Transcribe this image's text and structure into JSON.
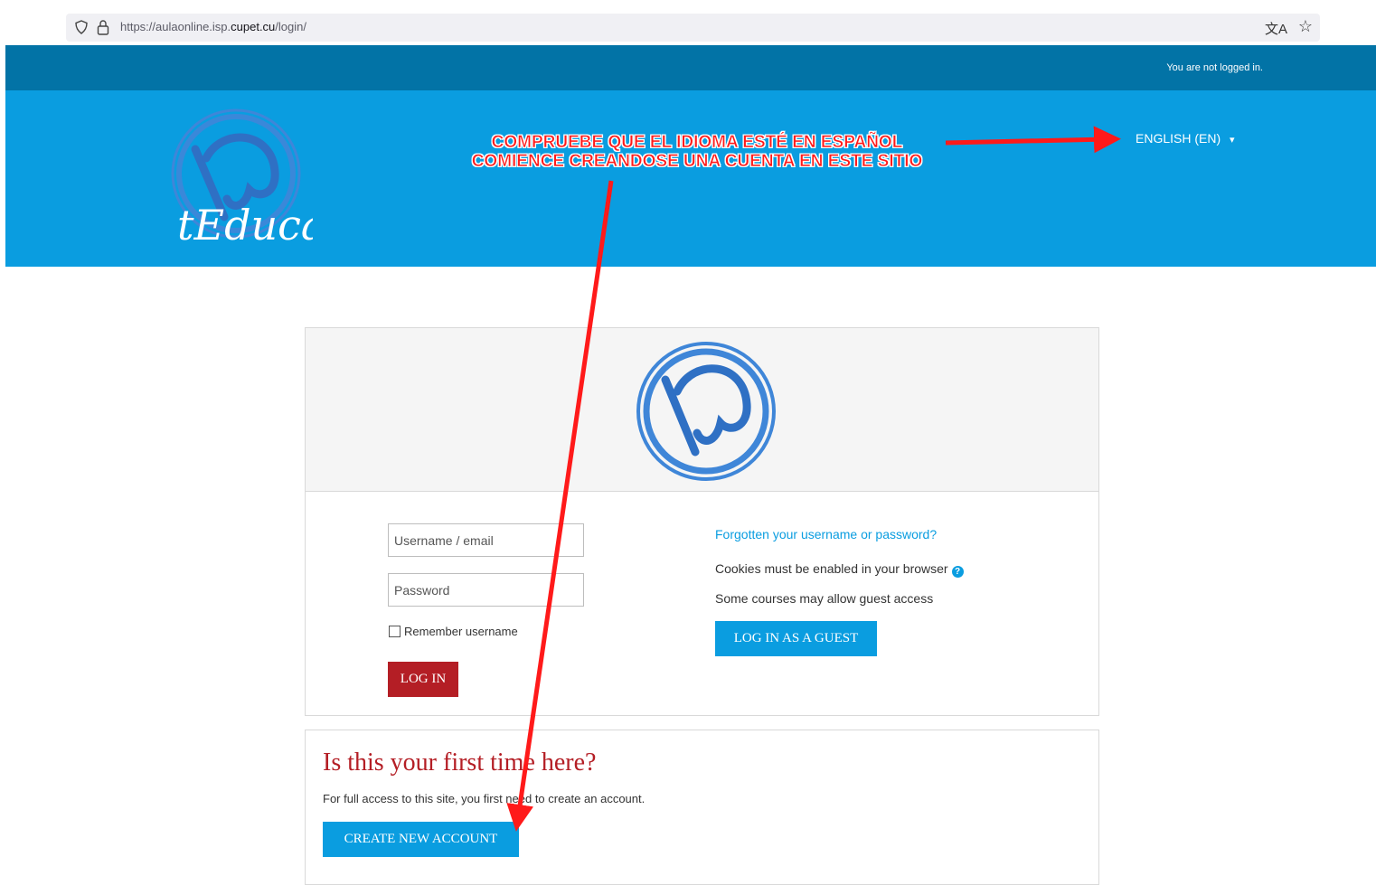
{
  "browser": {
    "url_prefix": "https://aulaonline.isp.",
    "url_domain": "cupet.cu",
    "url_path": "/login/",
    "translate_icon": "文A",
    "star_icon": "☆"
  },
  "navbar": {
    "status": "You are not logged in."
  },
  "header": {
    "logo_text": "tEduca",
    "language": "ENGLISH (EN)",
    "language_caret": "▾"
  },
  "annotation": {
    "line1": "COMPRUEBE QUE EL IDIOMA ESTÉ EN ESPAÑOL",
    "line2": "COMIENCE CREANDOSE UNA CUENTA EN ESTE SITIO",
    "color": "#ff1a1a"
  },
  "login": {
    "username_placeholder": "Username / email",
    "password_placeholder": "Password",
    "remember_label": "Remember username",
    "login_button": "LOG IN",
    "forgot_link": "Forgotten your username or password?",
    "cookies_text": "Cookies must be enabled in your browser",
    "help_icon": "?",
    "guest_note": "Some courses may allow guest access",
    "guest_button": "LOG IN AS A GUEST"
  },
  "signup": {
    "heading": "Is this your first time here?",
    "text": "For full access to this site, you first need to create an account.",
    "create_button": "CREATE NEW ACCOUNT"
  },
  "colors": {
    "navbar": "#0273a6",
    "header": "#0a9de0",
    "primary_button": "#0a9de0",
    "login_button": "#b41e25"
  }
}
